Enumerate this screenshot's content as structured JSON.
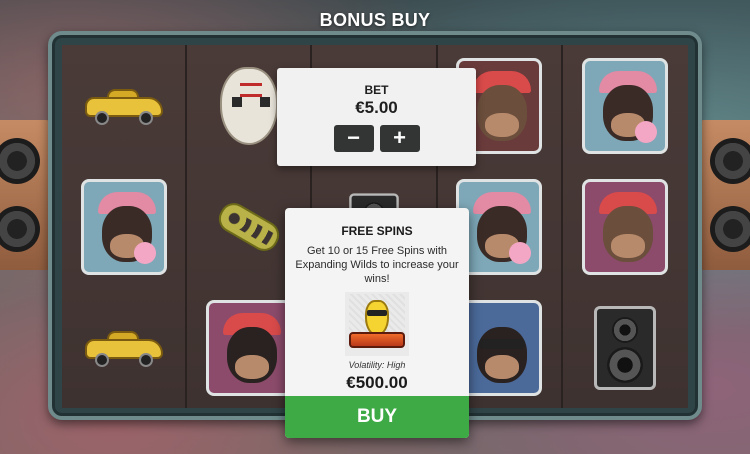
{
  "header": {
    "title": "BONUS BUY"
  },
  "bet": {
    "label": "BET",
    "value": "€5.00",
    "decrease_label": "−",
    "increase_label": "+"
  },
  "feature": {
    "title": "FREE SPINS",
    "description": "Get 10 or 15 Free Spins with Expanding Wilds to increase your wins!",
    "icon": "free-spins-banana-icon",
    "volatility": "Volatility: High",
    "price": "€500.00",
    "buy_label": "BUY"
  },
  "reels": [
    [
      "car",
      "ape-cap-gum",
      "car"
    ],
    [
      "hockey-mask",
      "brass-knuckles",
      "ape-cap"
    ],
    [
      "speaker",
      "speaker",
      "ape-cap"
    ],
    [
      "ape-cap-glasses",
      "ape-cap-gum",
      "ape-sunglasses"
    ],
    [
      "ape-cap-gum",
      "ape-cap",
      "speaker"
    ]
  ],
  "colors": {
    "buy_button": "#3daa45",
    "bet_buttons": "#333535",
    "panel_bg": "#f1f1f1"
  }
}
